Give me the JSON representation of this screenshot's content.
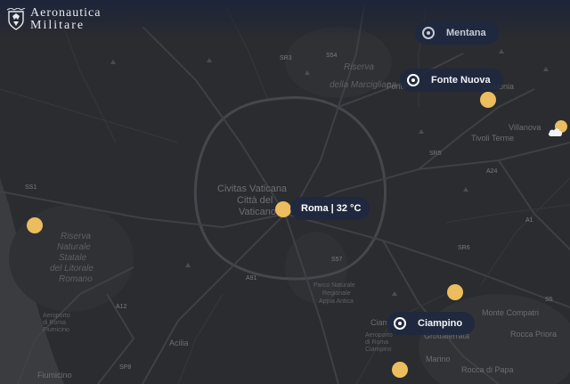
{
  "brand": {
    "line1": "Aeronautica",
    "line2": "Militare"
  },
  "map_labels": {
    "civitas": "Civitas Vaticana",
    "citta": "Città del",
    "vaticano": "Vaticano",
    "riserva1": [
      "Riserva",
      "Naturale",
      "Statale",
      "del Litorale",
      "Romano"
    ],
    "riserva2": [
      "Riserva",
      "della Marcigliana"
    ],
    "riserva3": [
      "Parco Naturale",
      "Regionale",
      "Appia Antica"
    ],
    "fonte": "Fonte",
    "tivoli": "Tivoli Terme",
    "villanova": "Villanova",
    "mandola": "Guidonia",
    "monte_compatri": "Monte Compatri",
    "grottaferrata": "Grottaferrata",
    "rocca_priora": "Rocca Priora",
    "marino": "Marino",
    "rocca_papa": "Rocca di Papa",
    "fiumicino": "Fiumicino",
    "acilia": "Acilia",
    "ciampino_town": "Ciam",
    "aeroporto": [
      "Aeroporto",
      "di Roma",
      "Fiumicino"
    ],
    "aeroporto2": [
      "Aeroporto",
      "di Roma",
      "Ciampino"
    ],
    "roads": [
      "SR3",
      "S54",
      "SS1",
      "SR5",
      "A24",
      "A1",
      "SR6",
      "S57",
      "A91",
      "A12",
      "SP8",
      "S5"
    ]
  },
  "stations": [
    {
      "name": "Mentana",
      "active": false
    },
    {
      "name": "Fonte Nuova",
      "active": true
    },
    {
      "name": "Ciampino",
      "active": true
    }
  ],
  "city_label": "Roma | 32 °C",
  "colors": {
    "dot": "#ebbd5f",
    "pill": "#1e2840",
    "land": "#2b2c2f",
    "sea": "#3b3c40"
  }
}
